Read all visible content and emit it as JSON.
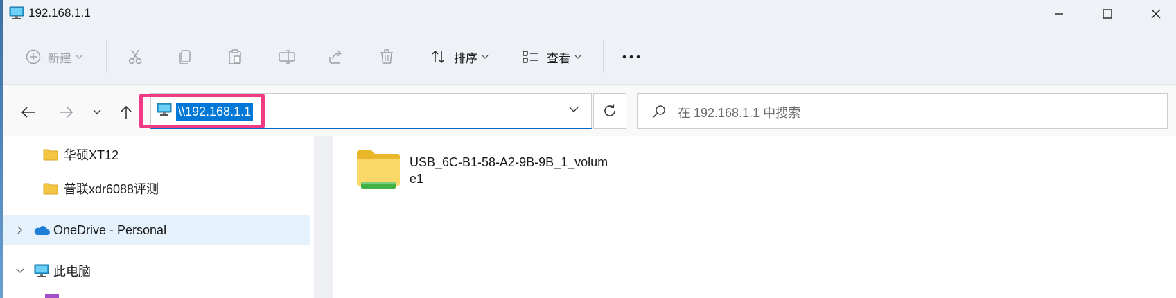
{
  "window": {
    "title": "192.168.1.1"
  },
  "commandbar": {
    "new_label": "新建",
    "sort_label": "排序",
    "view_label": "查看"
  },
  "address": {
    "path": "\\\\192.168.1.1",
    "search_placeholder": "在 192.168.1.1 中搜索"
  },
  "sidebar": {
    "items": [
      {
        "label": "华硕XT12",
        "icon": "folder-icon"
      },
      {
        "label": "普联xdr6088评测",
        "icon": "folder-icon"
      },
      {
        "label": "OneDrive - Personal",
        "icon": "cloud-icon",
        "selected": true
      },
      {
        "label": "此电脑",
        "icon": "computer-icon"
      }
    ]
  },
  "content": {
    "items": [
      {
        "name": "USB_6C-B1-58-A2-9B-9B_1_volume1",
        "icon": "usb-drive-folder-icon"
      }
    ]
  },
  "colors": {
    "accent": "#0078d7",
    "highlight_box": "#f03a84",
    "selected_row": "#e5f1fb"
  }
}
